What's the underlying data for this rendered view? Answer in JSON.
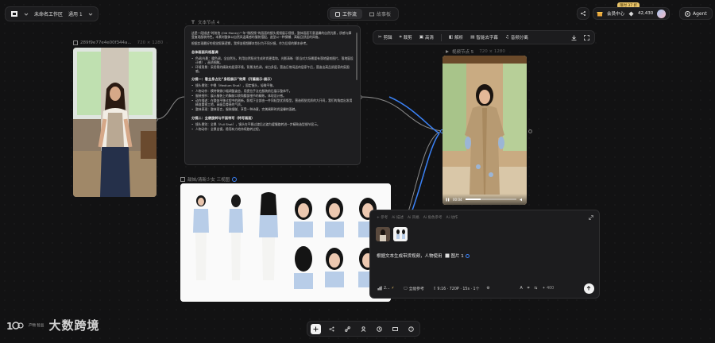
{
  "header": {
    "project_name": "未命名工作区",
    "version_label": "通用 1",
    "tabs": [
      {
        "label": "工作流",
        "active": true
      },
      {
        "label": "故事板",
        "active": false
      }
    ],
    "promo_badge": "限时 37 折",
    "member_center": "会员中心",
    "points": "42,430",
    "agent_label": "Agent"
  },
  "nodes": {
    "image1": {
      "label": "289f9e77e4e00f344a...",
      "meta": "720 × 1280"
    },
    "text": {
      "label": "文本节点 4",
      "intro": "这是一段描述“时装拍 (Old Money)”“年”微视频”的画面的镜头视频展示视频，整体画面写意温馨的自然光影，质感与摩登复现服装特色，本素材整体以自然风温柔感的服装搭配，造型以一种慵懒、高级且舒适的风格。",
      "intro2": "根据实现最好的视觉叙事逻辑，我将该视频脚本划分为不同分镜，作为后续的脚本参考。",
      "sec1_title": "总体画面风格基调",
      "sec1_items": [
        "色调/光影：暖色调，全自然光，利用自然阳光生成时尚更柔和，光影清晰（即当对大场景要有落地窗前图片，落地窗设计感），画质细腻。",
        "环境背景：采用简约精致的居家环境，背景浅色调，米白多层，营造日常闲适的居家午后，营造出高品质居家的氛围感。"
      ],
      "sec2_title": "分镜一：看全身占比“身段展示”效果（开篇展示-展示）",
      "sec2_items": [
        "镜头景别：中景（Medium Shot），固定镜头，轻微平移。",
        "人物动作：模特微微小幅调整姿态，用提拉手法在服装前后展示整体平。",
        "服装细节：展示服装上的胸前口袋和腰部细节的精致，体现设计感。",
        "动作描述：在整体平移过程中的刷新，照相下全部由一件同轻型优质版型，营造视觉优质的大开间，我们的角度出发用精准重视工地，高级且尊贵的气质。",
        "整体表现：整体而言，服装细腻、享受一种诗意，完美阐释时尚温馨的面貌。"
      ],
      "sec3_title": "分镜二：全貌旋转与平面特写（特写画面）",
      "sec3_items": [
        "镜头景别：全景（Full Shot），镜头在平稳过渡后过渡为缓慢旋转进一步精致造型细节显示。",
        "人物动作：全景出镜，稳而有力地持续旋转过程。"
      ]
    },
    "board": {
      "label": "甜妹/清新少女 三视图"
    },
    "video": {
      "label": "视频节点 5",
      "meta": "720 × 1280",
      "time": "00:04",
      "progress": 0.3
    },
    "video_toolbar": [
      "剪辑",
      "裁剪",
      "高清",
      "解析",
      "智能去字幕",
      "音频分离"
    ]
  },
  "chat": {
    "tabs": [
      "+ 参考",
      "Ai 描述",
      "Ai 风格",
      "Ai 角色参考",
      "Ai 动作"
    ],
    "prompt_text": "根据文本生成带货视频，人物使用",
    "ref_label": "图片 1",
    "model_label": "2...",
    "ref_mode": "全能参考",
    "params": "9:16 · 720P · 15s · 1个",
    "count_label": "400"
  },
  "watermark": {
    "text": "大数跨境",
    "sub": "产物 智品"
  },
  "colors": {
    "accent": "#3b82f6",
    "promo": "#e9c46a",
    "panel": "#1c1c1e"
  }
}
